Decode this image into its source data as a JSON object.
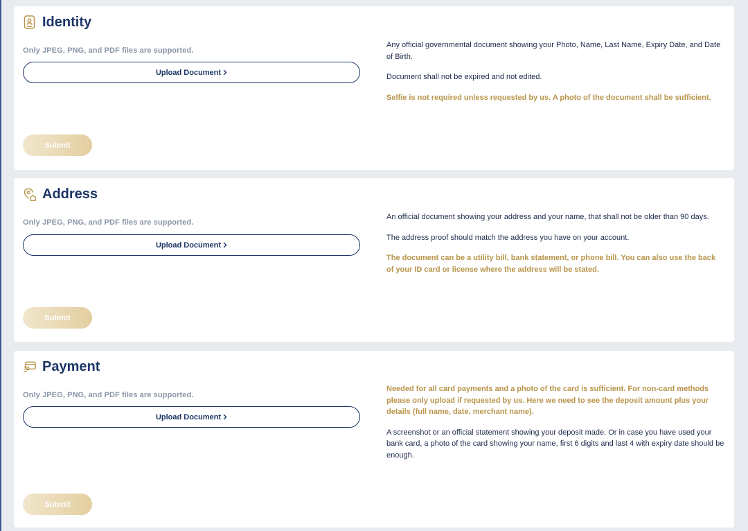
{
  "colors": {
    "navy": "#1d3566",
    "gold": "#b8944a",
    "hint_gray": "#8a94a6",
    "page_bg": "#e8ebef"
  },
  "sections": [
    {
      "title": "Identity",
      "icon": "id-document-icon",
      "hint": "Only JPEG, PNG, and PDF files are supported.",
      "upload_label": "Upload Document",
      "submit_label": "Submit",
      "info": [
        {
          "style": "plain",
          "text": "Any official governmental document showing your Photo, Name, Last Name, Expiry Date, and Date of Birth."
        },
        {
          "style": "plain",
          "text": "Document shall not be expired and not edited."
        },
        {
          "style": "gold",
          "text": "Selfie is not required unless requested by us. A photo of the document shall be sufficient."
        }
      ]
    },
    {
      "title": "Address",
      "icon": "location-home-icon",
      "hint": "Only JPEG, PNG, and PDF files are supported.",
      "upload_label": "Upload Document",
      "submit_label": "Submit",
      "info": [
        {
          "style": "plain",
          "text": "An official document showing your address and your name, that shall not be older than 90 days."
        },
        {
          "style": "plain",
          "text": "The address proof should match the address you have on your account."
        },
        {
          "style": "gold",
          "text": "The document can be a utility bill, bank statement, or phone bill. You can also use the back of your ID card or license where the address will be stated."
        }
      ]
    },
    {
      "title": "Payment",
      "icon": "payment-card-icon",
      "hint": "Only JPEG, PNG, and PDF files are supported.",
      "upload_label": "Upload Document",
      "submit_label": "Submit",
      "info": [
        {
          "style": "gold",
          "text": "Needed for all card payments and a photo of the card is sufficient. For non-card methods please only upload if requested by us. Here we need to see the deposit amount plus your details (full name, date, merchant name)."
        },
        {
          "style": "plain",
          "text": "A screenshot or an official statement showing your deposit made. Or in case you have used your bank card, a photo of the card showing your name, first 6 digits and last 4 with expiry date should be enough."
        }
      ]
    }
  ]
}
